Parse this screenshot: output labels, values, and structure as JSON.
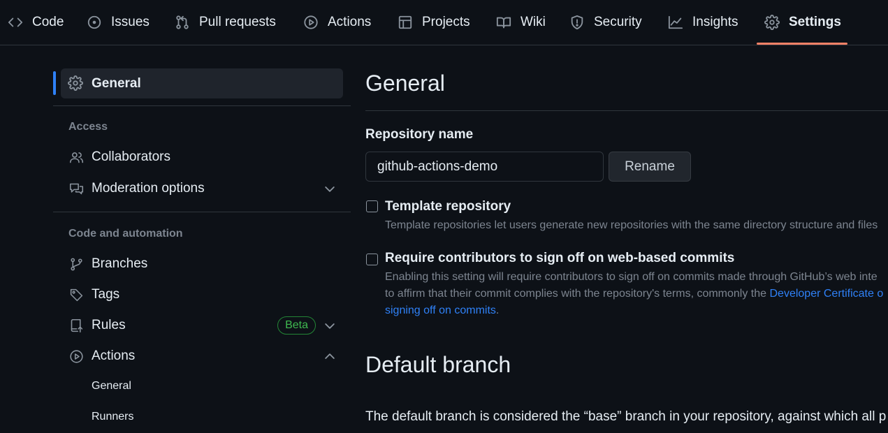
{
  "topnav": {
    "tabs": [
      {
        "label": "Code",
        "icon": "code-icon"
      },
      {
        "label": "Issues",
        "icon": "issue-opened-icon"
      },
      {
        "label": "Pull requests",
        "icon": "git-pull-request-icon"
      },
      {
        "label": "Actions",
        "icon": "play-icon"
      },
      {
        "label": "Projects",
        "icon": "table-icon"
      },
      {
        "label": "Wiki",
        "icon": "book-icon"
      },
      {
        "label": "Security",
        "icon": "shield-icon"
      },
      {
        "label": "Insights",
        "icon": "graph-icon"
      },
      {
        "label": "Settings",
        "icon": "gear-icon",
        "active": true
      }
    ],
    "active_underline_color": "#f78166"
  },
  "sidebar": {
    "general_label": "General",
    "access_heading": "Access",
    "collaborators_label": "Collaborators",
    "moderation_label": "Moderation options",
    "code_automation_heading": "Code and automation",
    "branches_label": "Branches",
    "tags_label": "Tags",
    "rules_label": "Rules",
    "rules_badge": "Beta",
    "actions_label": "Actions",
    "actions_sub": [
      "General",
      "Runners"
    ],
    "accent_color": "#2f81f7"
  },
  "main": {
    "title": "General",
    "repo_name_label": "Repository name",
    "repo_name_value": "github-actions-demo",
    "rename_button": "Rename",
    "template_title": "Template repository",
    "template_desc": "Template repositories let users generate new repositories with the same directory structure and files",
    "signoff_title": "Require contributors to sign off on web-based commits",
    "signoff_desc_line1": "Enabling this setting will require contributors to sign off on commits made through GitHub’s web inte",
    "signoff_desc_line2_prefix": "to affirm that their commit complies with the repository's terms, commonly the ",
    "signoff_desc_line2_link": "Developer Certificate o",
    "signoff_desc_line3_link": "signing off on commits",
    "signoff_desc_line3_suffix": ".",
    "default_branch_title": "Default branch",
    "default_branch_desc": "The default branch is considered the “base” branch in your repository, against which all p"
  }
}
